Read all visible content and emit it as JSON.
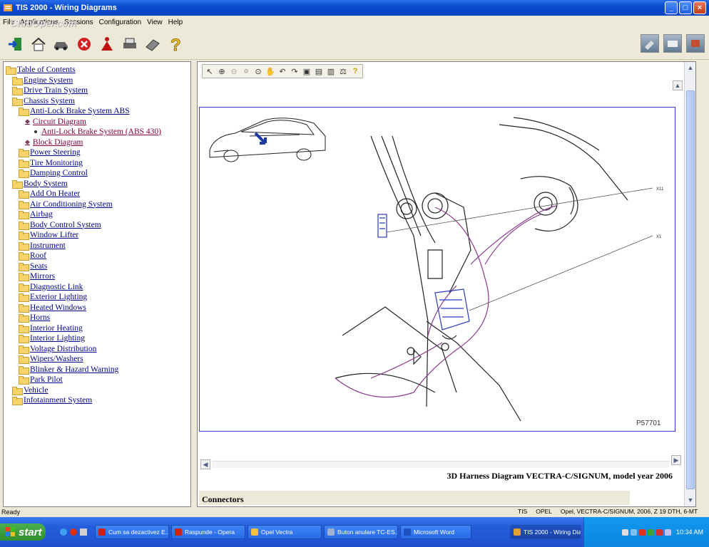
{
  "window": {
    "title": "TIS 2000 - Wiring Diagrams"
  },
  "watermark": "ClubOpel.com",
  "menu": [
    "File",
    "Applications",
    "Sessions",
    "Configuration",
    "View",
    "Help"
  ],
  "toolbar": {
    "icons": [
      "exit-icon",
      "home-icon",
      "car-icon",
      "stop-icon",
      "person-icon",
      "print-icon",
      "book-icon",
      "help-icon"
    ],
    "right_icons": [
      "tool-icon",
      "scanner-icon",
      "engine-icon"
    ]
  },
  "tree": {
    "items": [
      {
        "label": "Table of Contents",
        "depth": 0,
        "open": true
      },
      {
        "label": "Engine System",
        "depth": 1
      },
      {
        "label": "Drive Train System",
        "depth": 1
      },
      {
        "label": "Chassis System",
        "depth": 1,
        "open": true
      },
      {
        "label": "Anti-Lock Brake System ABS",
        "depth": 2,
        "open": true
      },
      {
        "label": "Circuit Diagram",
        "depth": 3,
        "book": true
      },
      {
        "label": "Anti-Lock Brake System (ABS 430)",
        "depth": 4,
        "leaf": true,
        "active": true
      },
      {
        "label": "Block Diagram",
        "depth": 3,
        "book": true
      },
      {
        "label": "Power Steering",
        "depth": 2
      },
      {
        "label": "Tire Monitoring",
        "depth": 2
      },
      {
        "label": "Damping Control",
        "depth": 2
      },
      {
        "label": "Body System",
        "depth": 1,
        "open": true
      },
      {
        "label": "Add On Heater",
        "depth": 2
      },
      {
        "label": "Air Conditioning System",
        "depth": 2
      },
      {
        "label": "Airbag",
        "depth": 2
      },
      {
        "label": "Body Control System",
        "depth": 2
      },
      {
        "label": "Window Lifter",
        "depth": 2
      },
      {
        "label": "Instrument",
        "depth": 2
      },
      {
        "label": "Roof",
        "depth": 2
      },
      {
        "label": "Seats",
        "depth": 2
      },
      {
        "label": "Mirrors",
        "depth": 2
      },
      {
        "label": "Diagnostic Link",
        "depth": 2
      },
      {
        "label": "Exterior Lighting",
        "depth": 2
      },
      {
        "label": "Heated Windows",
        "depth": 2
      },
      {
        "label": "Horns",
        "depth": 2
      },
      {
        "label": "Interior Heating",
        "depth": 2
      },
      {
        "label": "Interior Lighting",
        "depth": 2
      },
      {
        "label": "Voltage Distribution",
        "depth": 2
      },
      {
        "label": "Wipers/Washers",
        "depth": 2
      },
      {
        "label": "Blinker & Hazard Warning",
        "depth": 2
      },
      {
        "label": "Park Pilot",
        "depth": 2
      },
      {
        "label": "Vehicle",
        "depth": 1
      },
      {
        "label": "Infotainment System",
        "depth": 1
      }
    ]
  },
  "diagram": {
    "callouts": [
      "X11",
      "X1"
    ],
    "figure_id": "P57701",
    "caption": "3D Harness Diagram VECTRA-C/SIGNUM, model year 2006",
    "section": "Connectors",
    "tools": [
      "select-icon",
      "zoom-in-icon",
      "zoom-out-icon",
      "zoom-icon",
      "zoom-area-icon",
      "pan-icon",
      "rotate-left-icon",
      "rotate-right-icon",
      "fit-icon",
      "fit-height-icon",
      "fit-width-icon",
      "copy-icon",
      "help-icon"
    ]
  },
  "status": {
    "left": "Ready",
    "right": [
      "TIS",
      "OPEL",
      "Opel, VECTRA-C/SIGNUM, 2006, Z 19 DTH, 6-MT"
    ]
  },
  "taskbar": {
    "start": "start",
    "tasks": [
      {
        "label": "Cum sa dezactivez E...",
        "color": "#d02010"
      },
      {
        "label": "Raspunde - Opera",
        "color": "#d02010"
      },
      {
        "label": "Opel Vectra",
        "color": "#f0c040"
      },
      {
        "label": "Buton anulare TC-ES...",
        "color": "#a0b0d0"
      },
      {
        "label": "Microsoft Word",
        "color": "#2050c0"
      },
      {
        "label": "TIS 2000 - Wiring Dia...",
        "color": "#e0a030"
      }
    ],
    "clock": "10:34 AM"
  }
}
